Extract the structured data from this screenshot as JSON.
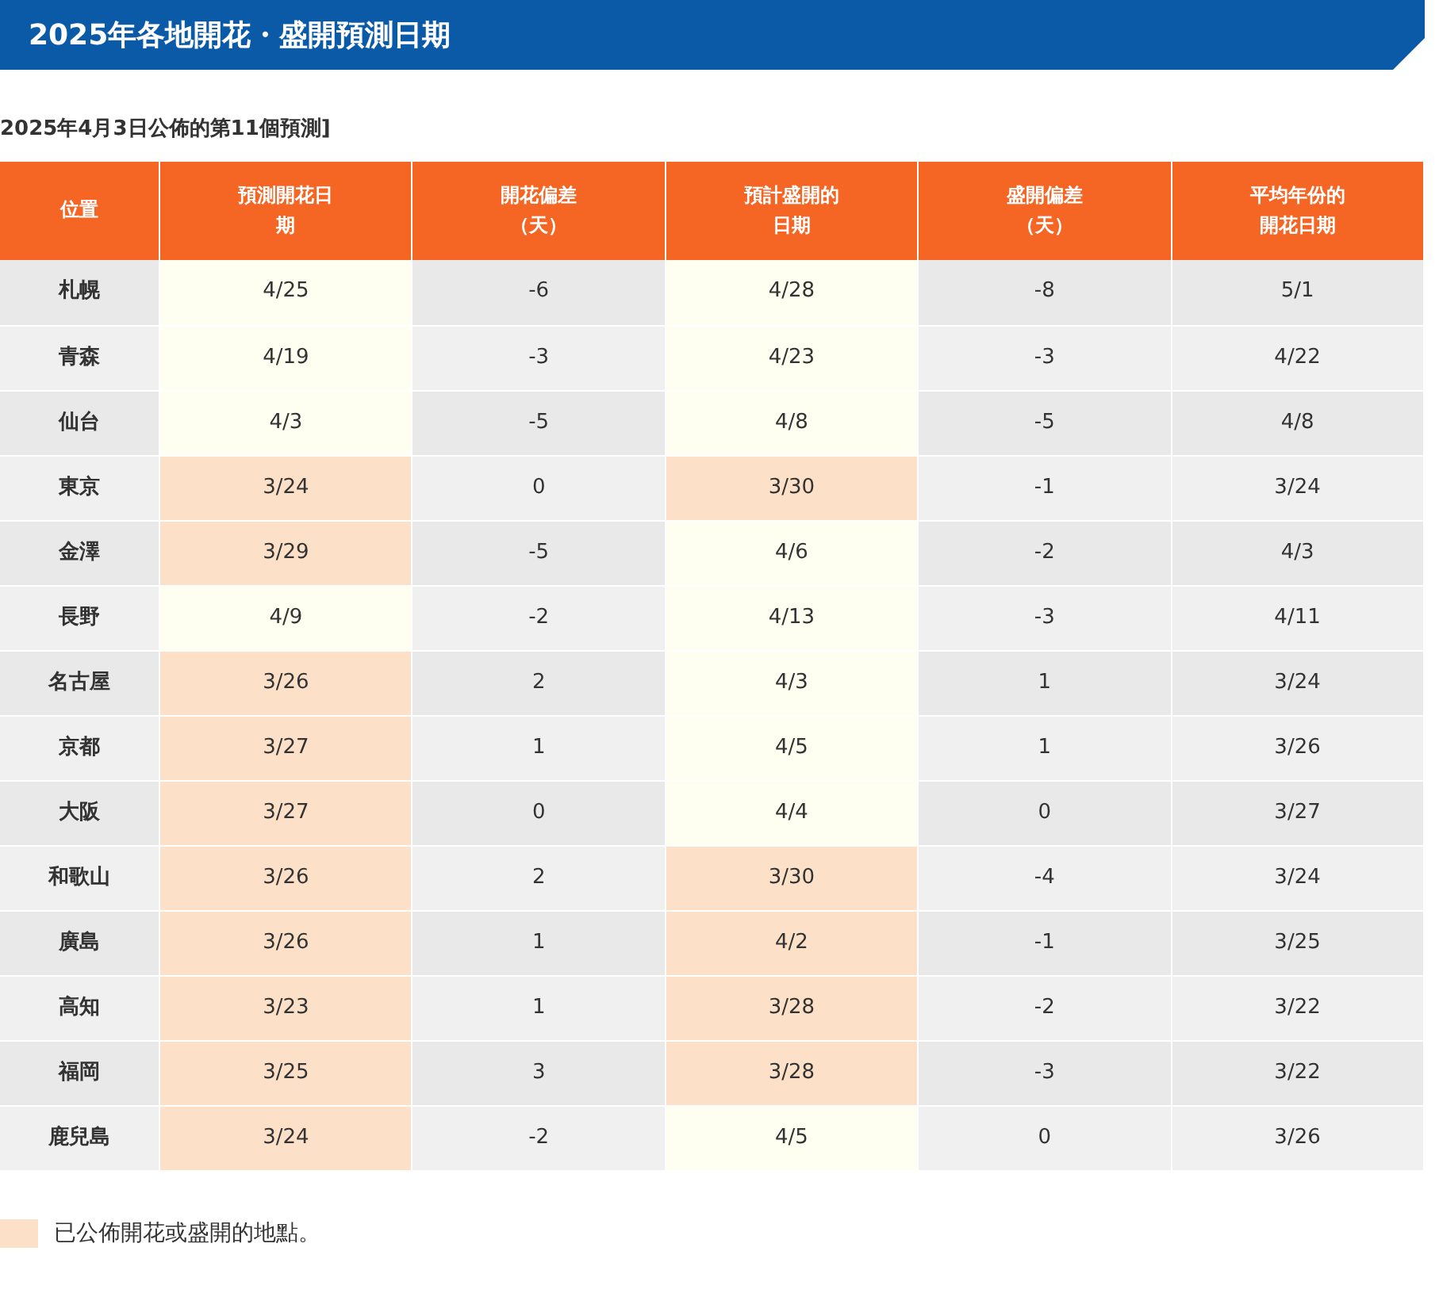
{
  "title": "2025年各地開花・盛開預測日期",
  "subtitle": "2025年4月3日公佈的第11個預測]",
  "columns": [
    "位置",
    "預測開花日期",
    "開花偏差（天）",
    "預計盛開的日期",
    "盛開偏差（天）",
    "平均年份的開花日期"
  ],
  "rows": [
    {
      "location": "札幌",
      "bloom": {
        "date": "4/25",
        "announced": false
      },
      "bloom_dev": "-6",
      "full": {
        "date": "4/28",
        "announced": false
      },
      "full_dev": "-8",
      "average": "5/1"
    },
    {
      "location": "青森",
      "bloom": {
        "date": "4/19",
        "announced": false
      },
      "bloom_dev": "-3",
      "full": {
        "date": "4/23",
        "announced": false
      },
      "full_dev": "-3",
      "average": "4/22"
    },
    {
      "location": "仙台",
      "bloom": {
        "date": "4/3",
        "announced": false
      },
      "bloom_dev": "-5",
      "full": {
        "date": "4/8",
        "announced": false
      },
      "full_dev": "-5",
      "average": "4/8"
    },
    {
      "location": "東京",
      "bloom": {
        "date": "3/24",
        "announced": true
      },
      "bloom_dev": "0",
      "full": {
        "date": "3/30",
        "announced": true
      },
      "full_dev": "-1",
      "average": "3/24"
    },
    {
      "location": "金澤",
      "bloom": {
        "date": "3/29",
        "announced": true
      },
      "bloom_dev": "-5",
      "full": {
        "date": "4/6",
        "announced": false
      },
      "full_dev": "-2",
      "average": "4/3"
    },
    {
      "location": "長野",
      "bloom": {
        "date": "4/9",
        "announced": false
      },
      "bloom_dev": "-2",
      "full": {
        "date": "4/13",
        "announced": false
      },
      "full_dev": "-3",
      "average": "4/11"
    },
    {
      "location": "名古屋",
      "bloom": {
        "date": "3/26",
        "announced": true
      },
      "bloom_dev": "2",
      "full": {
        "date": "4/3",
        "announced": false
      },
      "full_dev": "1",
      "average": "3/24"
    },
    {
      "location": "京都",
      "bloom": {
        "date": "3/27",
        "announced": true
      },
      "bloom_dev": "1",
      "full": {
        "date": "4/5",
        "announced": false
      },
      "full_dev": "1",
      "average": "3/26"
    },
    {
      "location": "大阪",
      "bloom": {
        "date": "3/27",
        "announced": true
      },
      "bloom_dev": "0",
      "full": {
        "date": "4/4",
        "announced": false
      },
      "full_dev": "0",
      "average": "3/27"
    },
    {
      "location": "和歌山",
      "bloom": {
        "date": "3/26",
        "announced": true
      },
      "bloom_dev": "2",
      "full": {
        "date": "3/30",
        "announced": true
      },
      "full_dev": "-4",
      "average": "3/24"
    },
    {
      "location": "廣島",
      "bloom": {
        "date": "3/26",
        "announced": true
      },
      "bloom_dev": "1",
      "full": {
        "date": "4/2",
        "announced": true
      },
      "full_dev": "-1",
      "average": "3/25"
    },
    {
      "location": "高知",
      "bloom": {
        "date": "3/23",
        "announced": true
      },
      "bloom_dev": "1",
      "full": {
        "date": "3/28",
        "announced": true
      },
      "full_dev": "-2",
      "average": "3/22"
    },
    {
      "location": "福岡",
      "bloom": {
        "date": "3/25",
        "announced": true
      },
      "bloom_dev": "3",
      "full": {
        "date": "3/28",
        "announced": true
      },
      "full_dev": "-3",
      "average": "3/22"
    },
    {
      "location": "鹿兒島",
      "bloom": {
        "date": "3/24",
        "announced": true
      },
      "bloom_dev": "-2",
      "full": {
        "date": "4/5",
        "announced": false
      },
      "full_dev": "0",
      "average": "3/26"
    }
  ],
  "legend": "已公佈開花或盛開的地點。"
}
